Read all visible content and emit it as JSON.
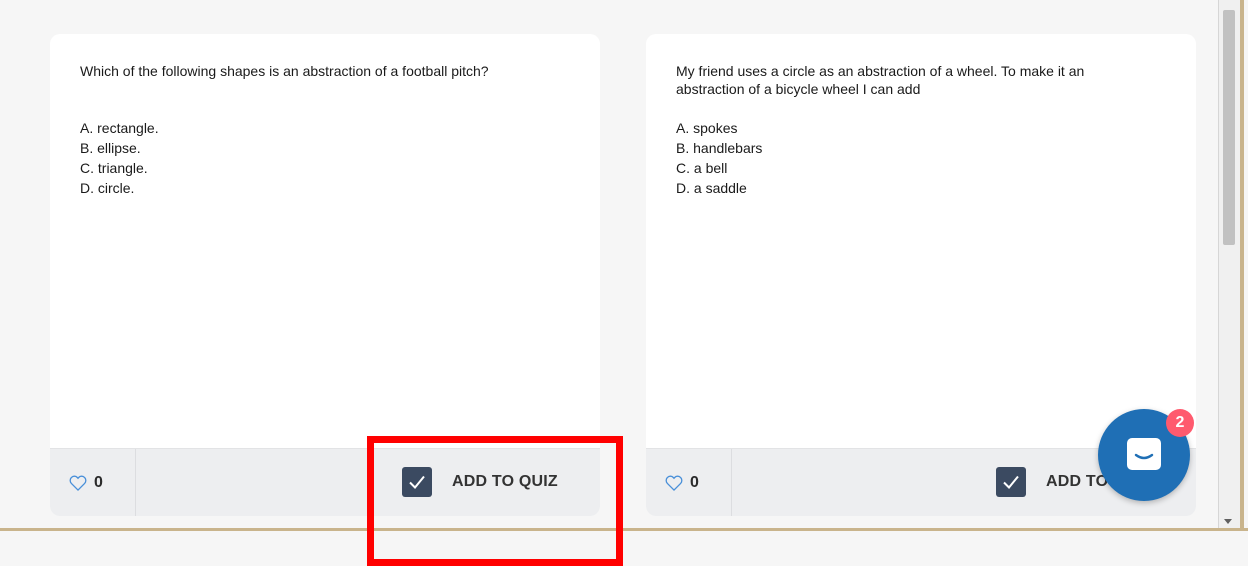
{
  "cards": [
    {
      "question": "Which of the following shapes is an abstraction of a football pitch?",
      "options": [
        "A. rectangle.",
        "B. ellipse.",
        "C. triangle.",
        "D. circle."
      ],
      "likes": "0",
      "add_label": "ADD TO QUIZ"
    },
    {
      "question": "My friend uses a circle as an abstraction of a wheel. To make it an abstraction of a bicycle wheel I can add",
      "options": [
        "A. spokes",
        "B. handlebars",
        "C. a bell",
        "D. a saddle"
      ],
      "likes": "0",
      "add_label": "ADD TO QUIZ"
    }
  ],
  "chat": {
    "badge": "2",
    "icon": "chat-bubble-icon"
  },
  "icons": {
    "like": "heart-icon",
    "add": "checkmark-icon"
  },
  "colors": {
    "checkbox": "#3b4a61",
    "chat": "#1f6fb5",
    "badge": "#ff5a6e",
    "highlight": "#ff0000",
    "heart": "#4a90d9"
  }
}
